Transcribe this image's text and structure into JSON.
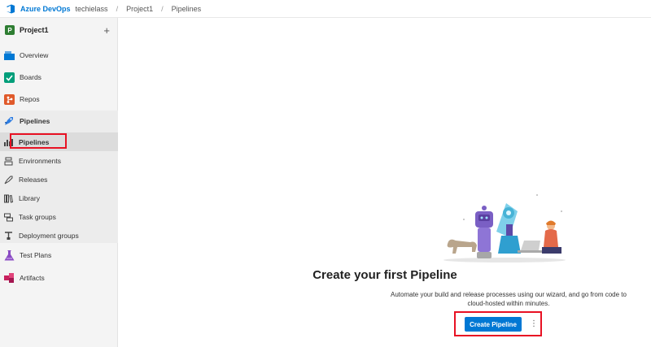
{
  "topbar": {
    "brand": "Azure DevOps",
    "org": "techielass",
    "sep1": "/",
    "project": "Project1",
    "sep2": "/",
    "page": "Pipelines"
  },
  "sidebar": {
    "project_badge": "P",
    "project_name": "Project1",
    "add": "+",
    "items": [
      {
        "label": "Overview"
      },
      {
        "label": "Boards"
      },
      {
        "label": "Repos"
      },
      {
        "label": "Pipelines"
      },
      {
        "label": "Pipelines"
      },
      {
        "label": "Environments"
      },
      {
        "label": "Releases"
      },
      {
        "label": "Library"
      },
      {
        "label": "Task groups"
      },
      {
        "label": "Deployment groups"
      },
      {
        "label": "Test Plans"
      },
      {
        "label": "Artifacts"
      }
    ]
  },
  "main": {
    "heading": "Create your first Pipeline",
    "description": "Automate your build and release processes using our wizard, and go from code to cloud-hosted within minutes.",
    "create_button": "Create Pipeline",
    "more": "⋮"
  },
  "colors": {
    "accent": "#0078d4",
    "highlight": "#e81123"
  }
}
